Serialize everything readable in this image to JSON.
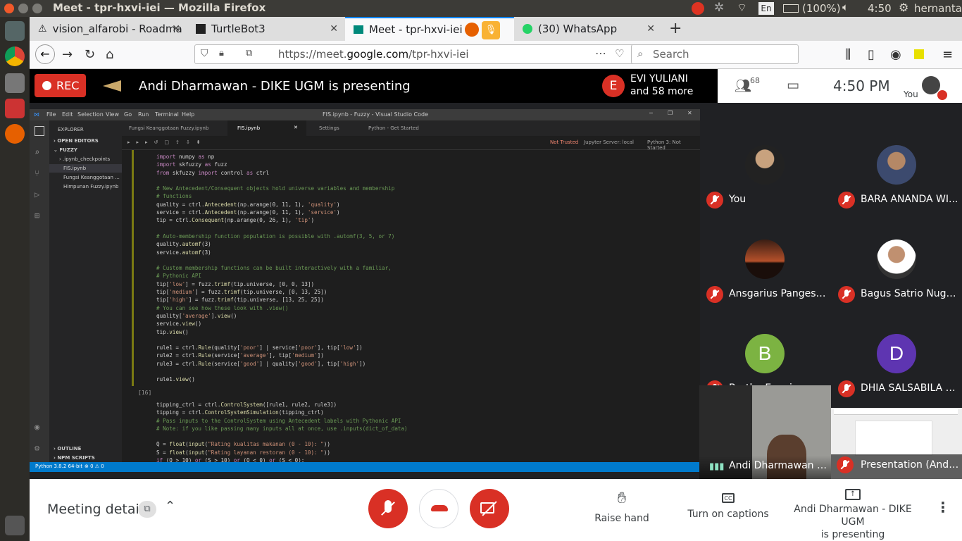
{
  "os": {
    "window_title": "Meet - tpr-hxvi-iei — Mozilla Firefox",
    "battery": "(100%)",
    "keyboard": "En",
    "time": "4:50",
    "user": "hernanta"
  },
  "browser": {
    "tabs": [
      {
        "label": "vision_alfarobi - Roadma",
        "icon": "github-icon"
      },
      {
        "label": "TurtleBot3",
        "icon": "robotis-icon"
      },
      {
        "label": "Meet - tpr-hxvi-iei",
        "icon": "meet-icon",
        "active": true
      },
      {
        "label": "(30) WhatsApp",
        "icon": "whatsapp-icon",
        "badge": "30"
      }
    ],
    "url_prefix": "https://meet.",
    "url_domain": "google.com",
    "url_path": "/tpr-hxvi-iei",
    "search_placeholder": "Search"
  },
  "meet": {
    "rec_label": "REC",
    "presenting_text": "Andi Dharmawan - DIKE UGM is presenting",
    "speaker_initial": "E",
    "speaker_name": "EVI YULIANI",
    "speaker_more": "and 58 more",
    "participant_count": "68",
    "clock": "4:50 PM",
    "self_label": "You",
    "participants": [
      {
        "name": "You",
        "kind": "photo"
      },
      {
        "name": "BARA ANANDA WI...",
        "kind": "photo"
      },
      {
        "name": "Ansgarius Pangestu...",
        "kind": "photo"
      },
      {
        "name": "Bagus Satrio Nugro...",
        "kind": "photo"
      },
      {
        "name": "Bertha Evania",
        "initial": "B",
        "color": "#7cb342"
      },
      {
        "name": "DHIA SALSABILA A...",
        "initial": "D",
        "color": "#5e35b1"
      }
    ],
    "presenter_tile_name": "Andi Dharmawan - D...",
    "presentation_tile_name": "Presentation (Andi ...",
    "meeting_details": "Meeting details",
    "raise_hand": "Raise hand",
    "captions": "Turn on captions",
    "presenting_line1": "Andi Dharmawan - DIKE UGM",
    "presenting_line2": "is presenting"
  },
  "vscode": {
    "title": "FIS.ipynb - Fuzzy - Visual Studio Code",
    "menu": [
      "File",
      "Edit",
      "Selection",
      "View",
      "Go",
      "Run",
      "Terminal",
      "Help"
    ],
    "explorer": "EXPLORER",
    "open_editors": "OPEN EDITORS",
    "folder": "FUZZY",
    "files": [
      ".ipynb_checkpoints",
      "FIS.ipynb",
      "Fungsi Keanggotaan ...",
      "Himpunan Fuzzy.ipynb"
    ],
    "outline": "OUTLINE",
    "npm": "NPM SCRIPTS",
    "tabs": [
      "Fungsi Keanggotaan Fuzzy.ipynb",
      "FIS.ipynb",
      "Settings",
      "Python - Get Started"
    ],
    "not_trusted": "Not Trusted",
    "jupyter": "Jupyter Server: local",
    "kernel": "Python 3: Not Started",
    "cell_label": "[16]",
    "status_python": "Python 3.8.2 64-bit",
    "status_problems": "⊗ 0 ⚠ 0"
  }
}
